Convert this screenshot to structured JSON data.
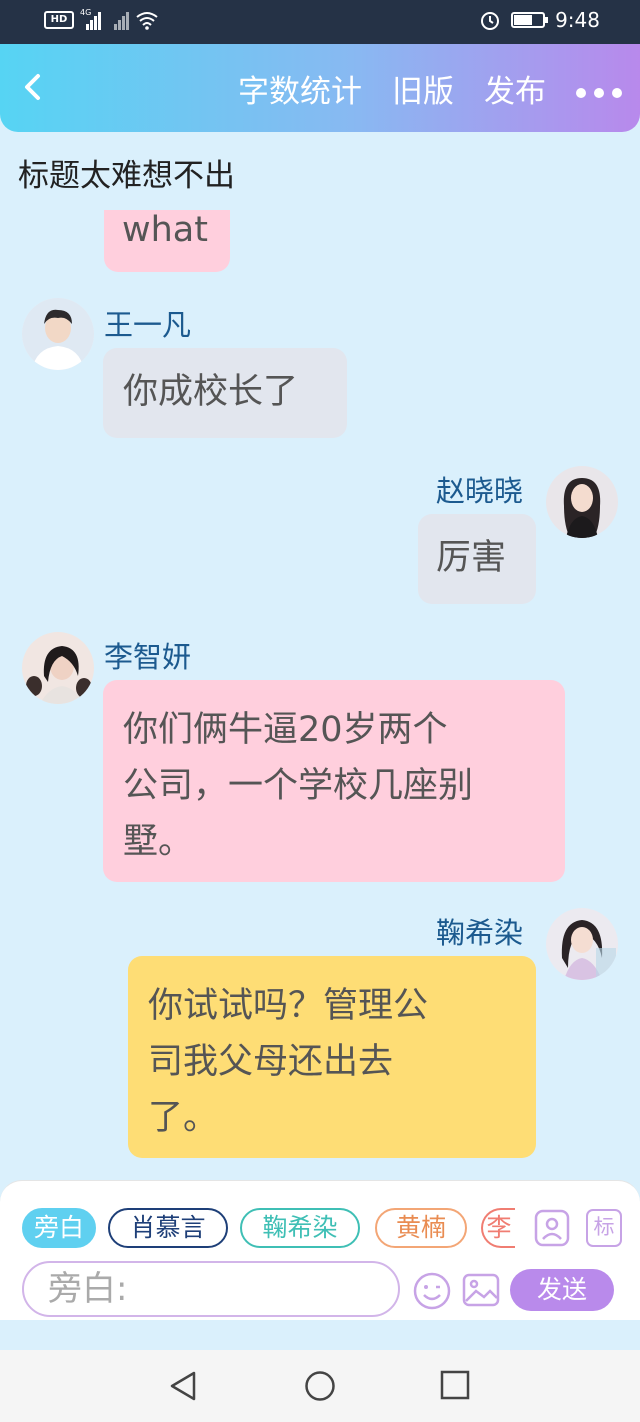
{
  "status": {
    "hd": "HD",
    "network": "4G",
    "time": "9:48"
  },
  "topbar": {
    "links": [
      "字数统计",
      "旧版",
      "发布"
    ]
  },
  "page_title": "标题太难想不出",
  "messages": [
    {
      "text": "what",
      "color": "#ffcfdd"
    },
    {
      "name": "王一凡",
      "text": "你成校长了",
      "side": "left"
    },
    {
      "name": "赵晓晓",
      "text": "厉害",
      "side": "right"
    },
    {
      "name": "李智妍",
      "lines": [
        "你们俩牛逼20岁两个",
        "公司，一个学校几座别",
        "墅。"
      ],
      "side": "left"
    },
    {
      "name": "鞠希染",
      "lines": [
        "你试试吗？管理公",
        "司我父母还出去",
        "了。"
      ],
      "side": "right"
    }
  ],
  "input_panel": {
    "chips": [
      "旁白",
      "肖慕言",
      "鞠希染",
      "黄楠",
      "李"
    ],
    "tag_label": "标",
    "placeholder": "旁白:",
    "send_label": "发送"
  }
}
